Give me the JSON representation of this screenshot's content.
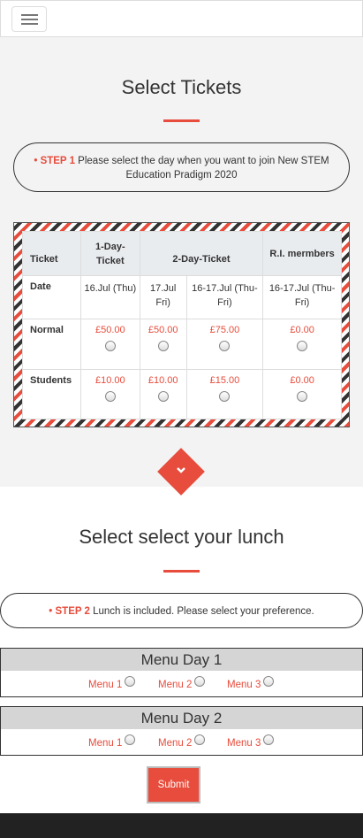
{
  "nav": {
    "menu_icon": "hamburger-icon"
  },
  "step1": {
    "title": "Select Tickets",
    "label": "• STEP 1",
    "text": " Please select the day when you want to join New STEM Education Pradigm 2020"
  },
  "ticket_table": {
    "headers": [
      "Ticket",
      "1-Day-Ticket",
      "2-Day-Ticket",
      "R.I. mermbers"
    ],
    "date_row": {
      "label": "Date",
      "cells": [
        "16.Jul (Thu)",
        "17.Jul Fri)",
        "16-17.Jul (Thu-Fri)",
        "16-17.Jul (Thu-Fri)"
      ]
    },
    "normal_row": {
      "label": "Normal",
      "prices": [
        "£50.00",
        "£50.00",
        "£75.00",
        "£0.00"
      ]
    },
    "students_row": {
      "label": "Students",
      "prices": [
        "£10.00",
        "£10.00",
        "£15.00",
        "£0.00"
      ]
    }
  },
  "divider": {
    "icon": "chevron-down-icon",
    "color": "#e74c3c"
  },
  "step2": {
    "title": "Select select your lunch",
    "label": "• STEP 2",
    "text": " Lunch is included. Please select your preference."
  },
  "menus": [
    {
      "title": "Menu Day 1",
      "options": [
        "Menu 1",
        "Menu 2",
        "Menu 3"
      ]
    },
    {
      "title": "Menu Day 2",
      "options": [
        "Menu 1",
        "Menu 2",
        "Menu 3"
      ]
    }
  ],
  "submit_label": "Submit",
  "colors": {
    "accent": "#e74c3c",
    "section_bg": "#f3f3f3",
    "footer": "#222222"
  }
}
